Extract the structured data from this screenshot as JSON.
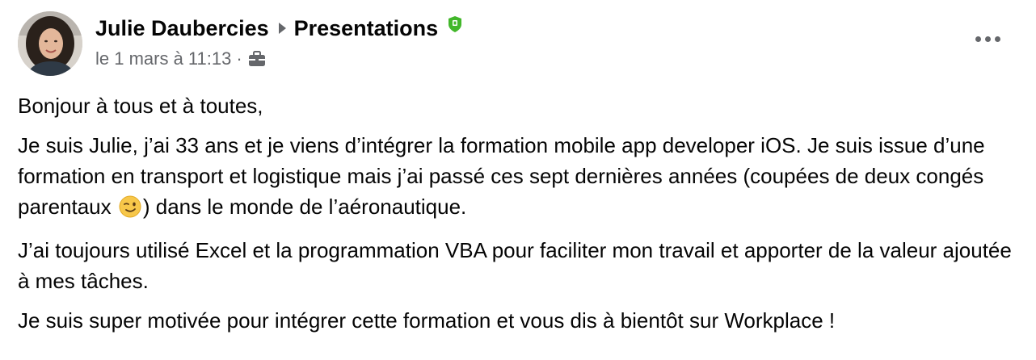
{
  "post": {
    "author": "Julie Daubercies",
    "group": "Presentations",
    "timestamp": "le 1 mars à 11:13",
    "meta_separator": "·",
    "icons": {
      "avatar": "profile-photo",
      "caret": "triangle-right-icon",
      "badge": "shield-badge-icon",
      "audience": "briefcase-icon",
      "more": "more-options-icon",
      "emoji": "winking-face-emoji"
    },
    "colors": {
      "text": "#050505",
      "secondary": "#65676b",
      "badge": "#42b72a"
    },
    "paragraphs": {
      "p1": "Bonjour à tous et à toutes,",
      "p2_before_emoji_line1": "Je suis Julie, j’ai 33 ans et je viens d’intégrer la formation mobile app developer iOS. Je suis issue d’une formation en transport et logistique mais j’ai passé ces sept dernières années (coupées de deux congés parentaux ",
      "p2_after_emoji": ") dans le monde de l’aéronautique.",
      "p3": "J’ai toujours utilisé Excel et la programmation VBA pour faciliter mon travail et apporter de la valeur ajoutée à mes tâches.",
      "p4": "Je suis super motivée pour intégrer cette formation et vous dis à bientôt sur Workplace !"
    }
  }
}
